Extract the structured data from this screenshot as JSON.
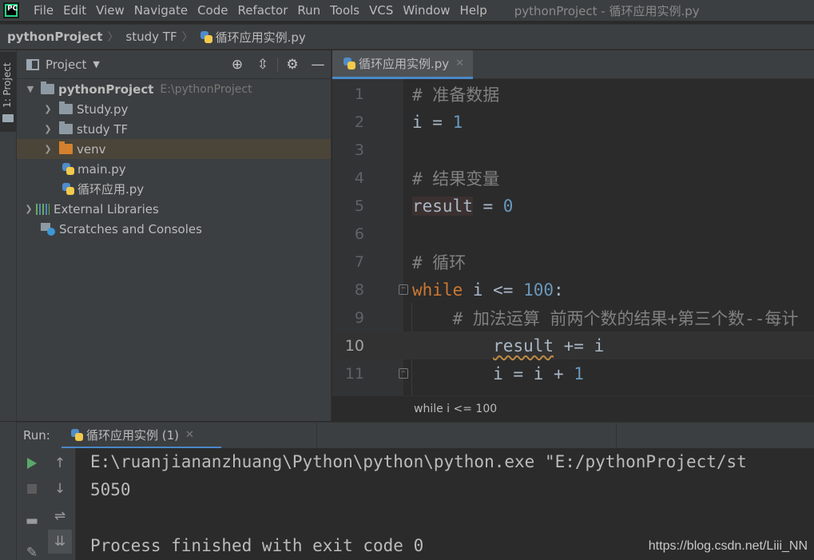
{
  "menubar": {
    "items": [
      "File",
      "Edit",
      "View",
      "Navigate",
      "Code",
      "Refactor",
      "Run",
      "Tools",
      "VCS",
      "Window",
      "Help"
    ],
    "window_title": "pythonProject - 循环应用实例.py",
    "logo_text": "PC"
  },
  "navbar": {
    "crumbs": [
      "pythonProject",
      "study TF",
      "循环应用实例.py"
    ]
  },
  "stripe": {
    "tab_label": "1: Project"
  },
  "project": {
    "title": "Project",
    "tree": [
      {
        "label": "pythonProject",
        "hint": "E:\\pythonProject"
      },
      {
        "label": "Study.py"
      },
      {
        "label": "study TF"
      },
      {
        "label": "venv"
      },
      {
        "label": "main.py"
      },
      {
        "label": "循环应用.py"
      },
      {
        "label": "External Libraries"
      },
      {
        "label": "Scratches and Consoles"
      }
    ]
  },
  "editor": {
    "tab_label": "循环应用实例.py",
    "lines": {
      "l1": "# 准备数据",
      "l2a": "i = ",
      "l2b": "1",
      "l4": "# 结果变量",
      "l5a": "result",
      "l5b": " = ",
      "l5c": "0",
      "l7": "# 循环",
      "l8a": "while",
      "l8b": " i <= ",
      "l8c": "100",
      "l8d": ":",
      "l9": "    # 加法运算 前两个数的结果+第三个数--每计",
      "l10a": "        ",
      "l10b": "result",
      "l10c": " += i",
      "l11a": "        i = i + ",
      "l11b": "1"
    },
    "line_numbers": [
      "1",
      "2",
      "3",
      "4",
      "5",
      "6",
      "7",
      "8",
      "9",
      "10",
      "11"
    ],
    "breadcrumb": "while i <= 100"
  },
  "run": {
    "label": "Run:",
    "tab_label": "循环应用实例 (1)",
    "console": [
      "E:\\ruanjiananzhuang\\Python\\python\\python.exe \"E:/pythonProject/st",
      "5050",
      "",
      "Process finished with exit code 0"
    ]
  },
  "watermark": "https://blog.csdn.net/Liii_NN",
  "colors": {
    "accent": "#4a88c7",
    "keyword": "#cc7832",
    "number": "#6897bb",
    "comment": "#808080"
  }
}
